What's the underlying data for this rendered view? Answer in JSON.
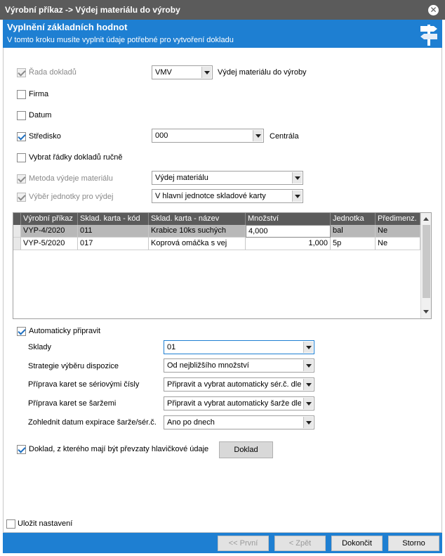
{
  "window": {
    "title": "Výrobní příkaz -> Výdej materiálu do výroby"
  },
  "header": {
    "title": "Vyplnění základních hodnot",
    "subtitle": "V tomto kroku musíte vyplnit údaje potřebné pro vytvoření dokladu"
  },
  "form": {
    "rada": {
      "label": "Řada dokladů",
      "checked": true,
      "disabled": true,
      "value": "VMV",
      "description": "Výdej materiálu do výroby"
    },
    "firma": {
      "label": "Firma",
      "checked": false
    },
    "datum": {
      "label": "Datum",
      "checked": false
    },
    "stredisko": {
      "label": "Středisko",
      "checked": true,
      "value": "000",
      "description": "Centrála"
    },
    "vybrat": {
      "label": "Vybrat řádky dokladů ručně",
      "checked": false
    },
    "metoda": {
      "label": "Metoda výdeje materiálu",
      "checked": true,
      "disabled": true,
      "value": "Výdej materiálu"
    },
    "vyber_jednotky": {
      "label": "Výběr jednotky pro výdej",
      "checked": true,
      "disabled": true,
      "value": "V hlavní jednotce skladové karty"
    }
  },
  "grid": {
    "columns": [
      "Výrobní příkaz",
      "Sklad. karta - kód",
      "Sklad. karta - název",
      "Množství",
      "Jednotka",
      "Předimenz."
    ],
    "rows": [
      {
        "prikaz": "VYP-4/2020",
        "kod": "011",
        "nazev": "Krabice 10ks suchých",
        "mnozstvi": "4,000",
        "jednotka": "bal",
        "predimenz": "Ne"
      },
      {
        "prikaz": "VYP-5/2020",
        "kod": "017",
        "nazev": "Koprová omáčka s vej",
        "mnozstvi": "1,000",
        "jednotka": "5p",
        "predimenz": "Ne"
      }
    ]
  },
  "auto": {
    "label": "Automaticky připravit",
    "checked": true,
    "sklady": {
      "label": "Sklady",
      "value": "01"
    },
    "strategie": {
      "label": "Strategie výběru dispozice",
      "value": "Od nejbližšího množství"
    },
    "seriova": {
      "label": "Příprava karet se sériovými čísly",
      "value": "Připravit a vybrat automaticky sér.č. dle"
    },
    "sarze": {
      "label": "Příprava karet se šaržemi",
      "value": "Připravit a vybrat automaticky šarže dle"
    },
    "expirace": {
      "label": "Zohlednit datum expirace šarže/sér.č.",
      "value": "Ano po dnech"
    }
  },
  "doklad": {
    "label": "Doklad, z kterého mají být převzaty hlavičkové údaje",
    "checked": true,
    "button": "Doklad"
  },
  "ulozit": {
    "label": "Uložit nastavení",
    "checked": false
  },
  "footer": {
    "prvni": "<< První",
    "zpet": "< Zpět",
    "dokoncit": "Dokončit",
    "storno": "Storno"
  },
  "colors": {
    "titlebar": "#5b5b5b",
    "accent": "#1e7fd2",
    "selected_row": "#b8b8b8"
  }
}
